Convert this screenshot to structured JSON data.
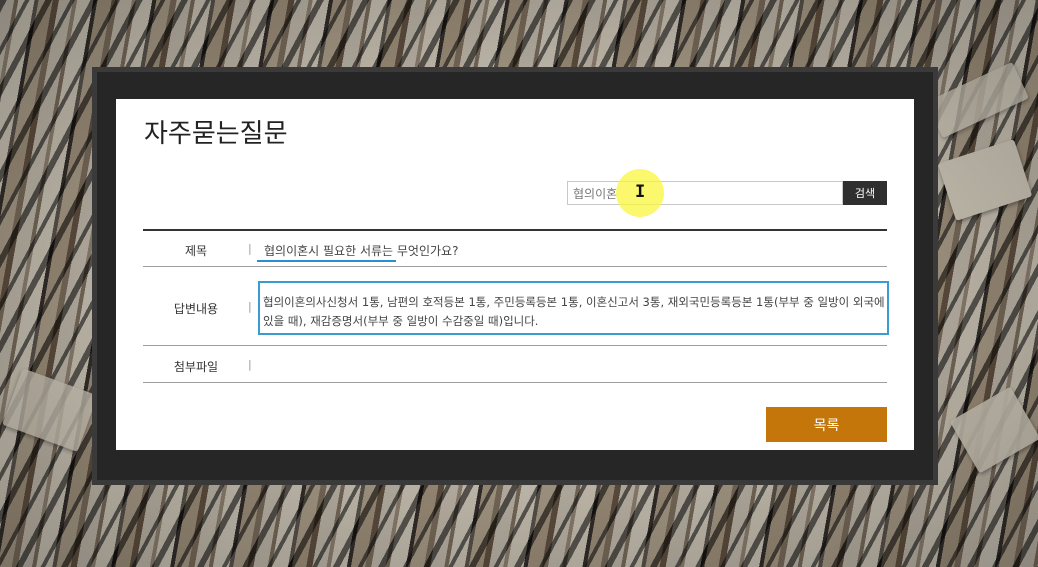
{
  "page": {
    "title": "자주묻는질문"
  },
  "search": {
    "value": "협의이혼",
    "button_label": "검색"
  },
  "rows": {
    "subject": {
      "label": "제목",
      "value": "협의이혼시 필요한 서류는 무엇인가요?"
    },
    "answer": {
      "label": "답변내용",
      "value": "협의이혼의사신청서 1통, 남편의 호적등본 1통, 주민등록등본 1통, 이혼신고서 3통, 재외국민등록등본 1통(부부 중 일방이 외국에 있을 때), 재감증명서(부부 중 일방이 수감중일 때)입니다."
    },
    "attachment": {
      "label": "첨부파일",
      "value": ""
    },
    "separator": "|"
  },
  "actions": {
    "list_label": "목록"
  },
  "colors": {
    "accent_button": "#c5760a",
    "focus_border": "#3a9bd0",
    "search_button": "#2f2f2f",
    "frame": "#262626"
  }
}
